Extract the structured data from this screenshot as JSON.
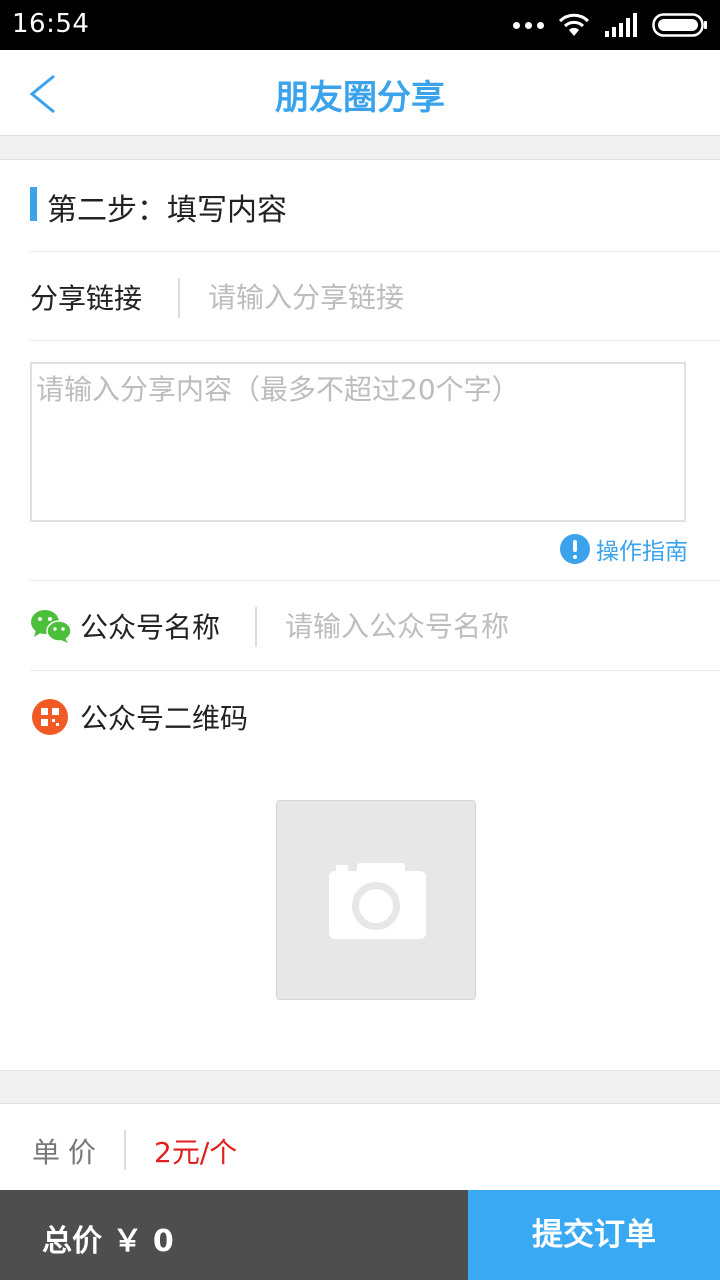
{
  "status_bar": {
    "time": "16:54"
  },
  "nav": {
    "title": "朋友圈分享"
  },
  "step": {
    "title": "第二步：填写内容"
  },
  "share_link": {
    "label": "分享链接",
    "placeholder": "请输入分享链接"
  },
  "content": {
    "placeholder": "请输入分享内容（最多不超过20个字）"
  },
  "guide": {
    "label": "操作指南"
  },
  "account_name": {
    "label": "公众号名称",
    "placeholder": "请输入公众号名称"
  },
  "qr_code": {
    "label": "公众号二维码"
  },
  "unit_price": {
    "label": "单价",
    "value": "2元/个"
  },
  "footer": {
    "total_label": "总价 ￥ 0",
    "submit_label": "提交订单"
  },
  "colors": {
    "accent": "#3aa3ec",
    "price_red": "#e0201f",
    "wechat_green": "#4cbf3b",
    "qr_orange": "#f15a24",
    "footer_dark": "#4e4e4e",
    "submit_blue": "#3aa9f3"
  }
}
